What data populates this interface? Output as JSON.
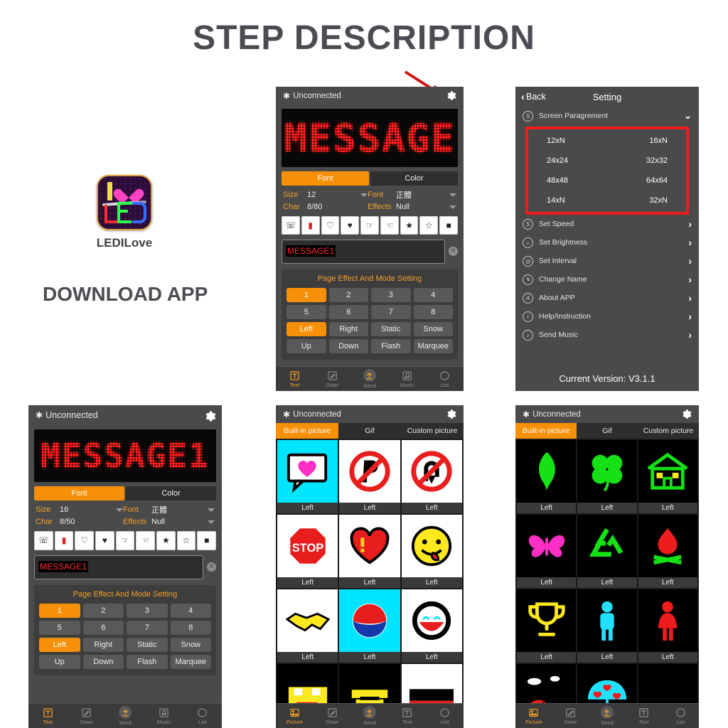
{
  "header": {
    "title": "STEP DESCRIPTION"
  },
  "download": {
    "app_name": "LEDILove",
    "cta": "DOWNLOAD APP",
    "icon": "ledilove-app-icon"
  },
  "annotations": {
    "arrow": "red-arrow-to-settings-gear"
  },
  "text_editor_top": {
    "status": {
      "bluetooth_icon": "bluetooth-icon",
      "connection": "Unconnected",
      "gear_icon": "gear-icon"
    },
    "led_preview": "MESSAGE",
    "tabs": [
      {
        "label": "Font",
        "active": true
      },
      {
        "label": "Color",
        "active": false
      }
    ],
    "attributes": [
      {
        "label": "Size",
        "value": "12"
      },
      {
        "label": "Font",
        "value": "正體"
      },
      {
        "label": "Char",
        "value": "8/80"
      },
      {
        "label": "Effects",
        "value": "Null"
      }
    ],
    "symbols": [
      "telephones-icon",
      "phone-booth-icon",
      "heart-outline-icon",
      "heart-filled-icon",
      "hand-point-right-icon",
      "hand-point-left-icon",
      "star-filled-icon",
      "star-outline-icon",
      "square-icon"
    ],
    "input_value": "MESSAGE1",
    "clear_icon": "clear-circle-icon",
    "effect_title": "Page Effect And Mode Setting",
    "effect_buttons": [
      {
        "label": "1",
        "active": true
      },
      {
        "label": "2",
        "active": false
      },
      {
        "label": "3",
        "active": false
      },
      {
        "label": "4",
        "active": false
      },
      {
        "label": "5",
        "active": false
      },
      {
        "label": "6",
        "active": false
      },
      {
        "label": "7",
        "active": false
      },
      {
        "label": "8",
        "active": false
      },
      {
        "label": "Left",
        "active": true
      },
      {
        "label": "Right",
        "active": false
      },
      {
        "label": "Static",
        "active": false
      },
      {
        "label": "Snow",
        "active": false
      },
      {
        "label": "Up",
        "active": false
      },
      {
        "label": "Down",
        "active": false
      },
      {
        "label": "Flash",
        "active": false
      },
      {
        "label": "Marquee",
        "active": false
      }
    ],
    "tabbar": [
      {
        "label": "Text",
        "icon": "text-icon",
        "active": true
      },
      {
        "label": "Draw",
        "icon": "draw-icon",
        "active": false
      },
      {
        "label": "Send",
        "icon": "send-icon",
        "active": false
      },
      {
        "label": "Music",
        "icon": "music-icon",
        "active": false
      },
      {
        "label": "List",
        "icon": "list-icon",
        "active": false
      }
    ]
  },
  "settings": {
    "back_label": "Back",
    "title": "Setting",
    "screen_section": {
      "icon": "s-circle-icon",
      "label": "Screen Paragrement",
      "chevron": "chevron-down-icon"
    },
    "sizes": [
      "12xN",
      "16xN",
      "24x24",
      "32x32",
      "48x48",
      "64x64",
      "14xN",
      "32xN"
    ],
    "rows": [
      {
        "label": "Set Speed",
        "icon": "s-circle-icon"
      },
      {
        "label": "Set Brightness",
        "icon": "brightness-circle-icon"
      },
      {
        "label": "Set Interval",
        "icon": "interval-circle-icon"
      },
      {
        "label": "Change Name",
        "icon": "pencil-circle-icon"
      },
      {
        "label": "About APP",
        "icon": "a-circle-icon"
      },
      {
        "label": "Help/Instruction",
        "icon": "info-circle-icon"
      },
      {
        "label": "Send Music",
        "icon": "music-circle-icon"
      }
    ],
    "version": "Current Version: V3.1.1",
    "highlight_color": "#ee1c1c"
  },
  "text_editor_bottom": {
    "status": {
      "bluetooth_icon": "bluetooth-icon",
      "connection": "Unconnected",
      "gear_icon": "gear-icon"
    },
    "led_preview": "MESSAGE1",
    "tabs": [
      {
        "label": "Font",
        "active": true
      },
      {
        "label": "Color",
        "active": false
      }
    ],
    "attributes": [
      {
        "label": "Size",
        "value": "16"
      },
      {
        "label": "Font",
        "value": "正體"
      },
      {
        "label": "Char",
        "value": "8/50"
      },
      {
        "label": "Effects",
        "value": "Null"
      }
    ],
    "input_value": "MESSAGE1",
    "effect_title": "Page Effect And Mode Setting",
    "effect_buttons": [
      {
        "label": "1",
        "active": true
      },
      {
        "label": "2",
        "active": false
      },
      {
        "label": "3",
        "active": false
      },
      {
        "label": "4",
        "active": false
      },
      {
        "label": "5",
        "active": false
      },
      {
        "label": "6",
        "active": false
      },
      {
        "label": "7",
        "active": false
      },
      {
        "label": "8",
        "active": false
      },
      {
        "label": "Left",
        "active": true
      },
      {
        "label": "Right",
        "active": false
      },
      {
        "label": "Static",
        "active": false
      },
      {
        "label": "Snow",
        "active": false
      },
      {
        "label": "Up",
        "active": false
      },
      {
        "label": "Down",
        "active": false
      },
      {
        "label": "Flash",
        "active": false
      },
      {
        "label": "Marquee",
        "active": false
      }
    ],
    "tabbar": [
      {
        "label": "Text",
        "icon": "text-icon",
        "active": true
      },
      {
        "label": "Draw",
        "icon": "draw-icon",
        "active": false
      },
      {
        "label": "Send",
        "icon": "send-icon",
        "active": false
      },
      {
        "label": "Music",
        "icon": "music-icon",
        "active": false
      },
      {
        "label": "List",
        "icon": "list-icon",
        "active": false
      }
    ]
  },
  "picture_gallery_color": {
    "status": {
      "connection": "Unconnected"
    },
    "tabs": [
      {
        "label": "Built-in picture",
        "active": true
      },
      {
        "label": "Gif",
        "active": false
      },
      {
        "label": "Custom picture",
        "active": false
      }
    ],
    "items": [
      {
        "icon": "speech-bubble-heart-icon",
        "caption": "Left"
      },
      {
        "icon": "no-parking-icon",
        "caption": "Left"
      },
      {
        "icon": "no-uturn-icon",
        "caption": "Left"
      },
      {
        "icon": "stop-sign-icon",
        "caption": "Left"
      },
      {
        "icon": "heart-exclamation-icon",
        "caption": "Left"
      },
      {
        "icon": "smiley-tongue-icon",
        "caption": "Left"
      },
      {
        "icon": "handshake-icon",
        "caption": "Left"
      },
      {
        "icon": "pepsi-logo-icon",
        "caption": "Left"
      },
      {
        "icon": "open-mouth-face-icon",
        "caption": "Left"
      },
      {
        "icon": "pacman-face-icon",
        "caption": ""
      },
      {
        "icon": "taxi-icon",
        "caption": ""
      },
      {
        "icon": "germany-flag-icon",
        "caption": ""
      }
    ],
    "tabbar": [
      {
        "label": "Picture",
        "icon": "picture-icon",
        "active": true
      },
      {
        "label": "Draw",
        "icon": "draw-icon",
        "active": false
      },
      {
        "label": "Send",
        "icon": "send-icon",
        "active": false
      },
      {
        "label": "Text",
        "icon": "text-icon",
        "active": false
      },
      {
        "label": "List",
        "icon": "list-icon",
        "active": false
      }
    ]
  },
  "picture_gallery_dark": {
    "status": {
      "connection": "Unconnected"
    },
    "tabs": [
      {
        "label": "Built-in picture",
        "active": true
      },
      {
        "label": "Gif",
        "active": false
      },
      {
        "label": "Custom picture",
        "active": false
      }
    ],
    "items": [
      {
        "icon": "leaf-icon",
        "caption": "Left"
      },
      {
        "icon": "four-leaf-clover-icon",
        "caption": "Left"
      },
      {
        "icon": "house-icon",
        "caption": "Left"
      },
      {
        "icon": "butterfly-icon",
        "caption": "Left"
      },
      {
        "icon": "recycle-icon",
        "caption": "Left"
      },
      {
        "icon": "campfire-icon",
        "caption": "Left"
      },
      {
        "icon": "trophy-icon",
        "caption": "Left"
      },
      {
        "icon": "man-figure-icon",
        "caption": "Left"
      },
      {
        "icon": "woman-figure-icon",
        "caption": "Left"
      },
      {
        "icon": "rabbit-clouds-icon",
        "caption": ""
      },
      {
        "icon": "umbrella-hearts-icon",
        "caption": ""
      },
      {
        "icon": "blank-icon",
        "caption": ""
      }
    ],
    "tabbar": [
      {
        "label": "Picture",
        "icon": "picture-icon",
        "active": true
      },
      {
        "label": "Draw",
        "icon": "draw-icon",
        "active": false
      },
      {
        "label": "Send",
        "icon": "send-icon",
        "active": false
      },
      {
        "label": "Text",
        "icon": "text-icon",
        "active": false
      },
      {
        "label": "List",
        "icon": "list-icon",
        "active": false
      }
    ]
  }
}
